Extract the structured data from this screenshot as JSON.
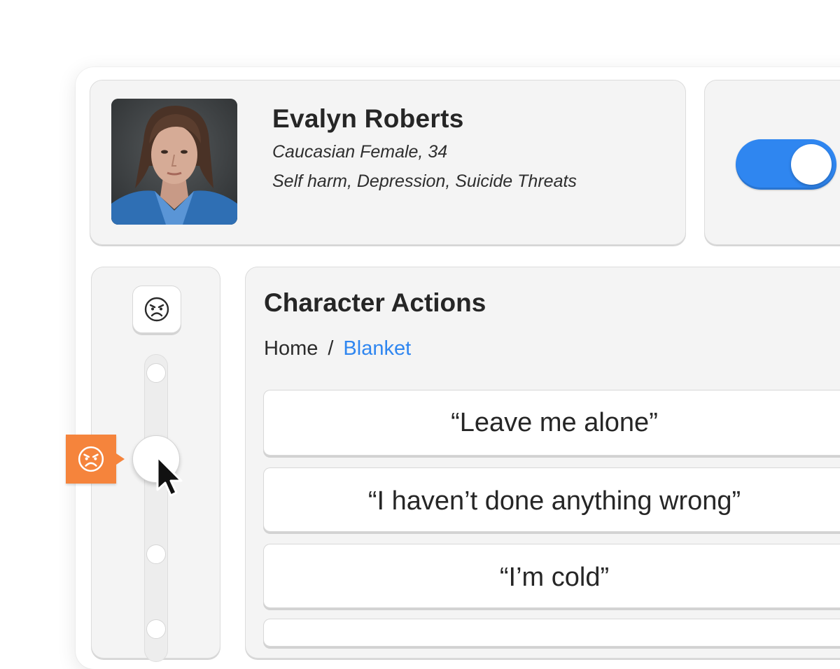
{
  "profile": {
    "name": "Evalyn Roberts",
    "demographics": "Caucasian Female, 34",
    "conditions": "Self harm, Depression, Suicide Threats"
  },
  "toggle": {
    "on": true
  },
  "mood": {
    "top_icon": "angry-face-icon",
    "indicator_icon": "angry-face-icon",
    "accent_color": "#f5843c"
  },
  "actions": {
    "title": "Character Actions",
    "breadcrumb": {
      "home": "Home",
      "separator": "/",
      "current": "Blanket"
    },
    "items": [
      {
        "label": "“Leave me alone”"
      },
      {
        "label": "“I haven’t done anything wrong”"
      },
      {
        "label": "“I’m cold”"
      },
      {
        "label": ""
      }
    ]
  },
  "colors": {
    "primary": "#2f86f0",
    "card_bg": "#f4f4f4"
  }
}
